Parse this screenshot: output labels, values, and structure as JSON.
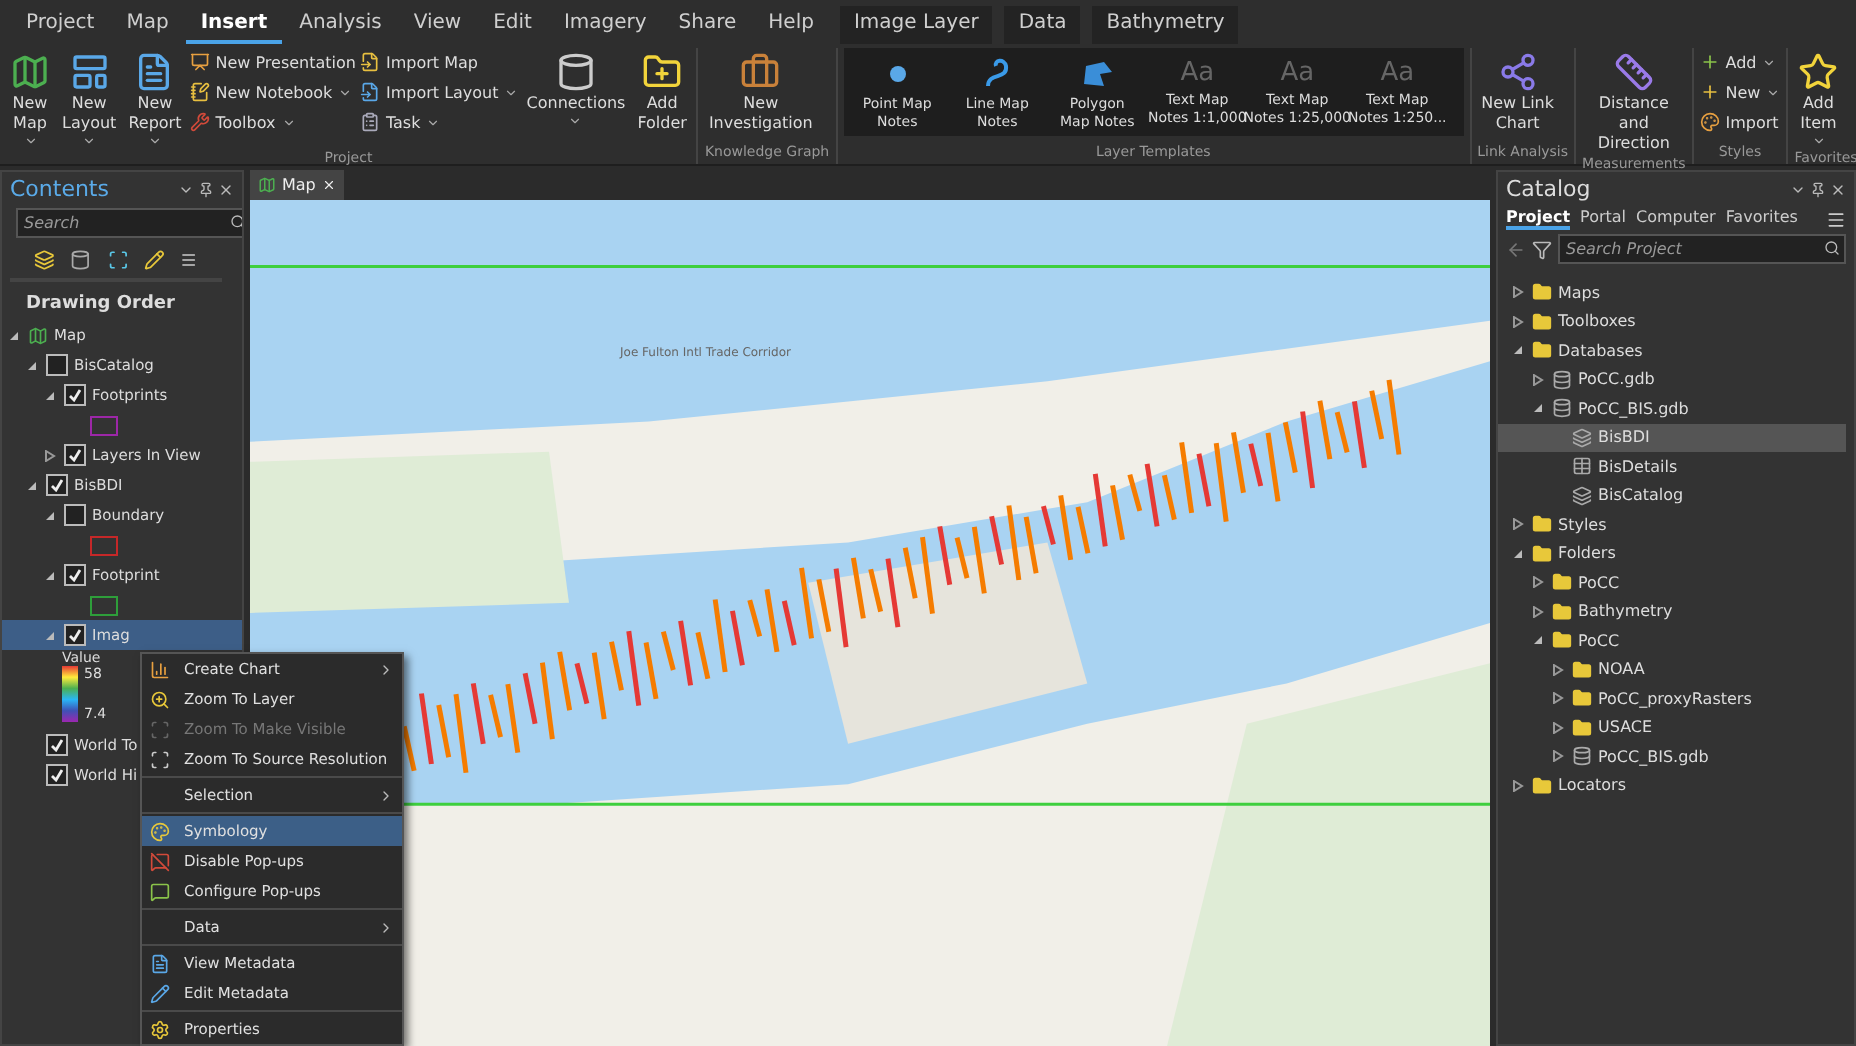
{
  "ribbon": {
    "tabs": [
      {
        "label": "Project",
        "selected": false,
        "kind": "main"
      },
      {
        "label": "Map",
        "selected": false,
        "kind": "main"
      },
      {
        "label": "Insert",
        "selected": true,
        "kind": "main"
      },
      {
        "label": "Analysis",
        "selected": false,
        "kind": "main"
      },
      {
        "label": "View",
        "selected": false,
        "kind": "main"
      },
      {
        "label": "Edit",
        "selected": false,
        "kind": "main"
      },
      {
        "label": "Imagery",
        "selected": false,
        "kind": "main"
      },
      {
        "label": "Share",
        "selected": false,
        "kind": "main"
      },
      {
        "label": "Help",
        "selected": false,
        "kind": "main"
      },
      {
        "label": "Image Layer",
        "selected": false,
        "kind": "contextual"
      },
      {
        "label": "Data",
        "selected": false,
        "kind": "contextual"
      },
      {
        "label": "Bathymetry",
        "selected": false,
        "kind": "contextual"
      }
    ],
    "groups": [
      {
        "label": "Project",
        "items": [
          {
            "kind": "large",
            "label": "New\nMap",
            "dropdown": true
          },
          {
            "kind": "large",
            "label": "New\nLayout",
            "dropdown": true
          },
          {
            "kind": "large",
            "label": "New\nReport",
            "dropdown": true
          },
          {
            "kind": "stack",
            "items": [
              {
                "label": "New Presentation",
                "dropdown": false
              },
              {
                "label": "New Notebook",
                "dropdown": true
              },
              {
                "label": "Toolbox",
                "dropdown": true
              }
            ]
          },
          {
            "kind": "stack",
            "items": [
              {
                "label": "Import Map",
                "dropdown": false
              },
              {
                "label": "Import Layout",
                "dropdown": true
              },
              {
                "label": "Task",
                "dropdown": true
              }
            ]
          },
          {
            "kind": "large",
            "label": "Connections",
            "dropdown": true
          },
          {
            "kind": "large",
            "label": "Add\nFolder",
            "dropdown": false
          }
        ]
      },
      {
        "label": "Knowledge Graph",
        "items": [
          {
            "kind": "large",
            "label": "New\nInvestigation",
            "dropdown": false
          }
        ]
      },
      {
        "label": "Layer Templates",
        "items": [
          {
            "kind": "gallery",
            "items": [
              {
                "kind": "point",
                "label": "Point Map\nNotes"
              },
              {
                "kind": "line",
                "label": "Line Map\nNotes"
              },
              {
                "kind": "polygon",
                "label": "Polygon\nMap Notes"
              },
              {
                "kind": "text",
                "glyph": "Aa",
                "label": "Text Map\nNotes 1:1,000"
              },
              {
                "kind": "text",
                "glyph": "Aa",
                "label": "Text Map\nNotes 1:25,000"
              },
              {
                "kind": "text",
                "glyph": "Aa",
                "label": "Text Map\nNotes 1:250..."
              }
            ]
          }
        ]
      },
      {
        "label": "Link Analysis",
        "items": [
          {
            "kind": "large",
            "label": "New Link\nChart",
            "dropdown": false
          }
        ]
      },
      {
        "label": "Measurements",
        "items": [
          {
            "kind": "large",
            "label": "Distance and\nDirection",
            "dropdown": false
          }
        ]
      },
      {
        "label": "Styles",
        "items": [
          {
            "kind": "stack",
            "items": [
              {
                "label": "Add",
                "dropdown": true
              },
              {
                "label": "New",
                "dropdown": true
              },
              {
                "label": "Import",
                "dropdown": false
              }
            ]
          }
        ]
      },
      {
        "label": "Favorites",
        "items": [
          {
            "kind": "large",
            "label": "Add\nItem",
            "dropdown": true
          }
        ]
      }
    ]
  },
  "contents": {
    "title": "Contents",
    "search": {
      "placeholder": "Search"
    },
    "heading": "Drawing Order",
    "tree": [
      {
        "label": "Map",
        "kind": "map",
        "expanded": true,
        "children": [
          {
            "label": "BisCatalog",
            "checked": false,
            "expanded": true,
            "children": [
              {
                "label": "Footprints",
                "checked": true,
                "expanded": true,
                "color": "#9c27a8"
              },
              {
                "label": "Layers In View",
                "checked": true,
                "expanded": false
              }
            ]
          },
          {
            "label": "BisBDI",
            "checked": true,
            "expanded": true,
            "children": [
              {
                "label": "Boundary",
                "checked": false,
                "expanded": true,
                "color": "#c62828"
              },
              {
                "label": "Footprint",
                "checked": true,
                "expanded": true,
                "color": "#2e9e3a"
              },
              {
                "label": "Imag",
                "checked": true,
                "expanded": true,
                "selected": true,
                "legend": {
                  "title": "Value",
                  "high": "58",
                  "low": "7.4"
                }
              }
            ]
          },
          {
            "label": "World To",
            "checked": true
          },
          {
            "label": "World Hi",
            "checked": true
          }
        ]
      }
    ]
  },
  "map_view": {
    "tab": "Map",
    "road_label": "Joe Fulton Intl Trade Corridor"
  },
  "context_menu": {
    "groups": [
      [
        {
          "label": "Create Chart",
          "submenu": true,
          "disabled": false,
          "selected": false
        },
        {
          "label": "Zoom To Layer",
          "submenu": false,
          "disabled": false,
          "selected": false
        },
        {
          "label": "Zoom To Make Visible",
          "submenu": false,
          "disabled": true,
          "selected": false
        },
        {
          "label": "Zoom To Source Resolution",
          "submenu": false,
          "disabled": false,
          "selected": false
        }
      ],
      [
        {
          "label": "Selection",
          "submenu": true,
          "disabled": false,
          "selected": false
        }
      ],
      [
        {
          "label": "Symbology",
          "submenu": false,
          "disabled": false,
          "selected": true
        },
        {
          "label": "Disable Pop-ups",
          "submenu": false,
          "disabled": false,
          "selected": false
        },
        {
          "label": "Configure Pop-ups",
          "submenu": false,
          "disabled": false,
          "selected": false
        }
      ],
      [
        {
          "label": "Data",
          "submenu": true,
          "disabled": false,
          "selected": false
        }
      ],
      [
        {
          "label": "View Metadata",
          "submenu": false,
          "disabled": false,
          "selected": false
        },
        {
          "label": "Edit Metadata",
          "submenu": false,
          "disabled": false,
          "selected": false
        }
      ],
      [
        {
          "label": "Properties",
          "submenu": false,
          "disabled": false,
          "selected": false
        }
      ]
    ]
  },
  "catalog": {
    "title": "Catalog",
    "tabs": [
      {
        "label": "Project",
        "selected": true
      },
      {
        "label": "Portal",
        "selected": false
      },
      {
        "label": "Computer",
        "selected": false
      },
      {
        "label": "Favorites",
        "selected": false
      }
    ],
    "search": {
      "placeholder": "Search Project"
    },
    "tree": [
      {
        "label": "Maps",
        "kind": "folder",
        "expanded": false
      },
      {
        "label": "Toolboxes",
        "kind": "folder",
        "expanded": false
      },
      {
        "label": "Databases",
        "kind": "folder",
        "expanded": true,
        "children": [
          {
            "label": "PoCC.gdb",
            "kind": "gdb",
            "expanded": false
          },
          {
            "label": "PoCC_BIS.gdb",
            "kind": "gdb",
            "expanded": true,
            "children": [
              {
                "label": "BisBDI",
                "kind": "dataset",
                "selected": true
              },
              {
                "label": "BisDetails",
                "kind": "table",
                "selected": false
              },
              {
                "label": "BisCatalog",
                "kind": "dataset",
                "selected": false
              }
            ]
          }
        ]
      },
      {
        "label": "Styles",
        "kind": "folder",
        "expanded": false
      },
      {
        "label": "Folders",
        "kind": "folder",
        "expanded": true,
        "children": [
          {
            "label": "PoCC",
            "kind": "folder",
            "expanded": false
          },
          {
            "label": "Bathymetry",
            "kind": "folder",
            "expanded": false
          },
          {
            "label": "PoCC",
            "kind": "folder",
            "expanded": true,
            "children": [
              {
                "label": "NOAA",
                "kind": "folder",
                "expanded": false
              },
              {
                "label": "PoCC_proxyRasters",
                "kind": "folder",
                "expanded": false
              },
              {
                "label": "USACE",
                "kind": "folder",
                "expanded": false
              },
              {
                "label": "PoCC_BIS.gdb",
                "kind": "gdb",
                "expanded": false
              }
            ]
          }
        ]
      },
      {
        "label": "Locators",
        "kind": "folder",
        "expanded": false
      }
    ]
  }
}
